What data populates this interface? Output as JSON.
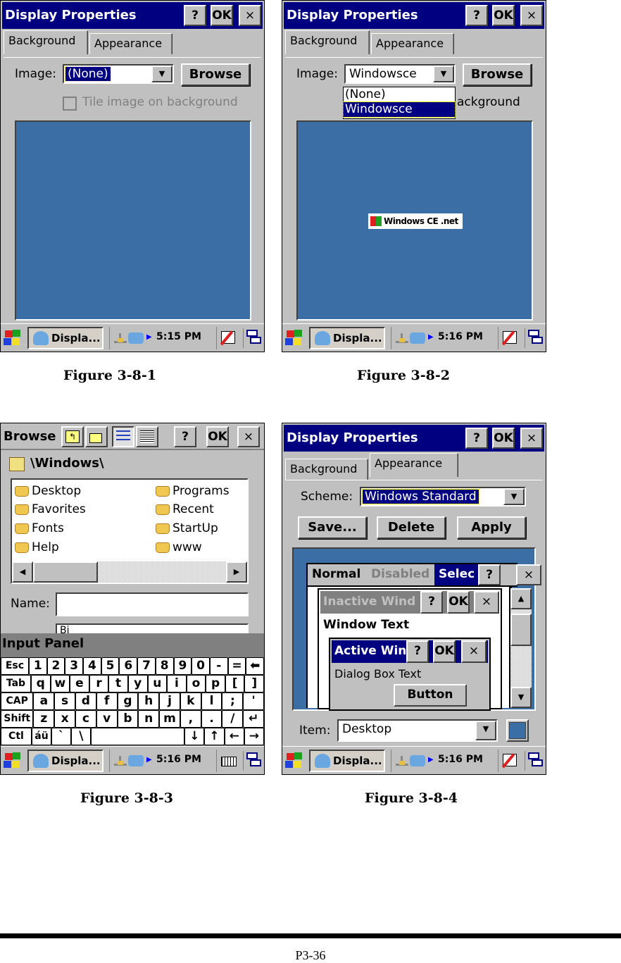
{
  "figures": [
    {
      "caption": "Figure 3-8-1",
      "window": {
        "title": "Display Properties",
        "help_label": "?",
        "ok_label": "OK",
        "close_label": "×",
        "tabs": [
          {
            "label": "Background",
            "active": true
          },
          {
            "label": "Appearance",
            "active": false
          }
        ],
        "image_label": "Image:",
        "image_value": "(None)",
        "browse_label": "Browse",
        "tile_label": "Tile image on background",
        "tile_checked": false,
        "tile_enabled": false
      },
      "taskbar": {
        "app_label": "Displa...",
        "time": "5:15 PM"
      }
    },
    {
      "caption": "Figure 3-8-2",
      "window": {
        "title": "Display Properties",
        "help_label": "?",
        "ok_label": "OK",
        "close_label": "×",
        "tabs": [
          {
            "label": "Background",
            "active": true
          },
          {
            "label": "Appearance",
            "active": false
          }
        ],
        "image_label": "Image:",
        "image_value": "Windowsce",
        "dropdown_options": [
          "(None)",
          "Windowsce"
        ],
        "dropdown_selected": "Windowsce",
        "browse_label": "Browse",
        "tile_label_visible": "ackground",
        "wallpaper_logo": "Windows CE .net"
      },
      "taskbar": {
        "app_label": "Displa...",
        "time": "5:16 PM"
      }
    },
    {
      "caption": "Figure 3-8-3",
      "browse": {
        "title": "Browse",
        "help_label": "?",
        "ok_label": "OK",
        "close_label": "×",
        "path": "\\Windows\\",
        "folders_col1": [
          "Desktop",
          "Favorites",
          "Fonts",
          "Help"
        ],
        "folders_col2": [
          "Programs",
          "Recent",
          "StartUp",
          "www"
        ],
        "name_label": "Name:",
        "name_value": "",
        "type_value_partial": "Bi"
      },
      "input_panel": {
        "title": "Input Panel",
        "rows": [
          [
            "Esc",
            "1",
            "2",
            "3",
            "4",
            "5",
            "6",
            "7",
            "8",
            "9",
            "0",
            "-",
            "=",
            "⬅"
          ],
          [
            "Tab",
            "q",
            "w",
            "e",
            "r",
            "t",
            "y",
            "u",
            "i",
            "o",
            "p",
            "[",
            "]"
          ],
          [
            "CAP",
            "a",
            "s",
            "d",
            "f",
            "g",
            "h",
            "j",
            "k",
            "l",
            ";",
            "'"
          ],
          [
            "Shift",
            "z",
            "x",
            "c",
            "v",
            "b",
            "n",
            "m",
            ",",
            ".",
            "/",
            "↵"
          ],
          [
            "Ctl",
            "áü",
            "`",
            "\\",
            " ",
            "↓",
            "↑",
            "←",
            "→"
          ]
        ]
      },
      "taskbar": {
        "app_label": "Displa...",
        "time": "5:16 PM"
      }
    },
    {
      "caption": "Figure 3-8-4",
      "window": {
        "title": "Display Properties",
        "help_label": "?",
        "ok_label": "OK",
        "close_label": "×",
        "tabs": [
          {
            "label": "Background",
            "active": false
          },
          {
            "label": "Appearance",
            "active": true
          }
        ],
        "scheme_label": "Scheme:",
        "scheme_value": "Windows Standard",
        "save_label": "Save...",
        "delete_label": "Delete",
        "apply_label": "Apply",
        "preview": {
          "menu_normal": "Normal",
          "menu_disabled": "Disabled",
          "menu_selected": "Selec",
          "inactive_title": "Inactive Wind",
          "window_text": "Window Text",
          "active_title": "Active Win",
          "dialog_text": "Dialog Box Text",
          "button_label": "Button"
        },
        "item_label": "Item:",
        "item_value": "Desktop",
        "item_color": "#3a6ea5"
      },
      "taskbar": {
        "app_label": "Displa...",
        "time": "5:16 PM"
      }
    }
  ],
  "page_number": "P3-36",
  "colors": {
    "titlebar": "#000080",
    "desktop": "#3a6ea5",
    "face": "#c0c0c0"
  }
}
